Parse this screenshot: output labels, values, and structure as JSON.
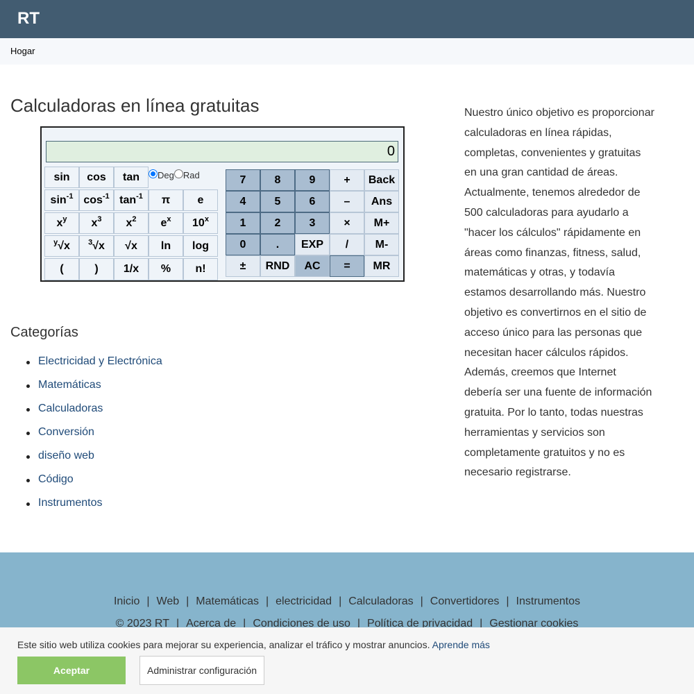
{
  "header": {
    "logo": "RT"
  },
  "breadcrumb": {
    "home": "Hogar"
  },
  "main": {
    "title": "Calculadoras en línea gratuitas"
  },
  "calculator": {
    "display_value": "0",
    "angle_mode": {
      "selected": "Deg",
      "options": [
        "Deg",
        "Rad"
      ]
    },
    "sci_keys": [
      [
        "sin",
        "cos",
        "tan"
      ],
      [
        "sin⁻¹",
        "cos⁻¹",
        "tan⁻¹",
        "π",
        "e"
      ],
      [
        "xʸ",
        "x³",
        "x²",
        "eˣ",
        "10ˣ"
      ],
      [
        "ʸ√x",
        "³√x",
        "√x",
        "ln",
        "log"
      ],
      [
        "(",
        ")",
        "1/x",
        "%",
        "n!"
      ]
    ],
    "sci_labels": {
      "sin": "sin",
      "cos": "cos",
      "tan": "tan",
      "asin_base": "sin",
      "acos_base": "cos",
      "atan_base": "tan",
      "inv_sup": "-1",
      "pi": "π",
      "e": "e",
      "x": "x",
      "y_sup": "y",
      "three_sup": "3",
      "two_sup": "2",
      "ex_base": "e",
      "x_sup": "x",
      "ten": "10",
      "root": "√x",
      "ln": "ln",
      "log": "log",
      "lparen": "(",
      "rparen": ")",
      "recip": "1/x",
      "percent": "%",
      "fact": "n!"
    },
    "basic_keys": {
      "k7": "7",
      "k8": "8",
      "k9": "9",
      "plus": "+",
      "back": "Back",
      "k4": "4",
      "k5": "5",
      "k6": "6",
      "minus": "–",
      "ans": "Ans",
      "k1": "1",
      "k2": "2",
      "k3": "3",
      "times": "×",
      "mplus": "M+",
      "k0": "0",
      "dot": ".",
      "exp": "EXP",
      "divide": "/",
      "mminus": "M-",
      "pm": "±",
      "rnd": "RND",
      "ac": "AC",
      "equals": "=",
      "mr": "MR"
    }
  },
  "categories": {
    "title": "Categorías",
    "items": [
      "Electricidad y Electrónica",
      "Matemáticas",
      "Calculadoras",
      "Conversión",
      "diseño web",
      "Código",
      "Instrumentos"
    ]
  },
  "about": {
    "text": "Nuestro único objetivo es proporcionar calculadoras en línea rápidas, completas, convenientes y gratuitas en una gran cantidad de áreas. Actualmente, tenemos alrededor de 500 calculadoras para ayudarlo a \"hacer los cálculos\" rápidamente en áreas como finanzas, fitness, salud, matemáticas y otras, y todavía estamos desarrollando más. Nuestro objetivo es convertirnos en el sitio de acceso único para las personas que necesitan hacer cálculos rápidos. Además, creemos que Internet debería ser una fuente de información gratuita. Por lo tanto, todas nuestras herramientas y servicios son completamente gratuitos y no es necesario registrarse."
  },
  "footer": {
    "nav": [
      "Inicio",
      "Web",
      "Matemáticas",
      "electricidad",
      "Calculadoras",
      "Convertidores",
      "Instrumentos"
    ],
    "copyright": "© 2023  RT",
    "legal": [
      "Acerca de",
      "Condiciones de uso",
      "Política de privacidad",
      "Gestionar cookies"
    ],
    "separator": "|"
  },
  "cookie_banner": {
    "text": "Este sitio web utiliza cookies para mejorar su experiencia, analizar el tráfico y mostrar anuncios.",
    "learn_more": "Aprende más",
    "accept": "Aceptar",
    "settings": "Administrar configuración"
  },
  "colors": {
    "header_bg": "#425c71",
    "footer_bg": "#86b4cc",
    "link": "#1f4a78",
    "accept_button": "#8cc665",
    "display_bg": "#e0efe0",
    "number_key_bg": "#a9bdd1"
  }
}
